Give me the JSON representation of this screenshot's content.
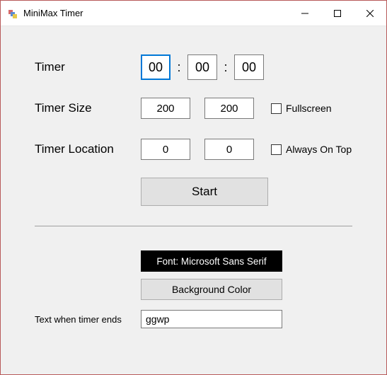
{
  "window": {
    "title": "MiniMax Timer"
  },
  "labels": {
    "timer": "Timer",
    "timer_size": "Timer Size",
    "timer_location": "Timer Location",
    "fullscreen": "Fullscreen",
    "always_on_top": "Always On Top",
    "start": "Start",
    "background_color": "Background Color",
    "end_text": "Text when timer ends"
  },
  "timer": {
    "hh": "00",
    "mm": "00",
    "ss": "00"
  },
  "size": {
    "w": "200",
    "h": "200"
  },
  "location": {
    "x": "0",
    "y": "0"
  },
  "checks": {
    "fullscreen": false,
    "always_on_top": false
  },
  "font_button": "Font: Microsoft Sans Serif",
  "end_text_value": "ggwp"
}
